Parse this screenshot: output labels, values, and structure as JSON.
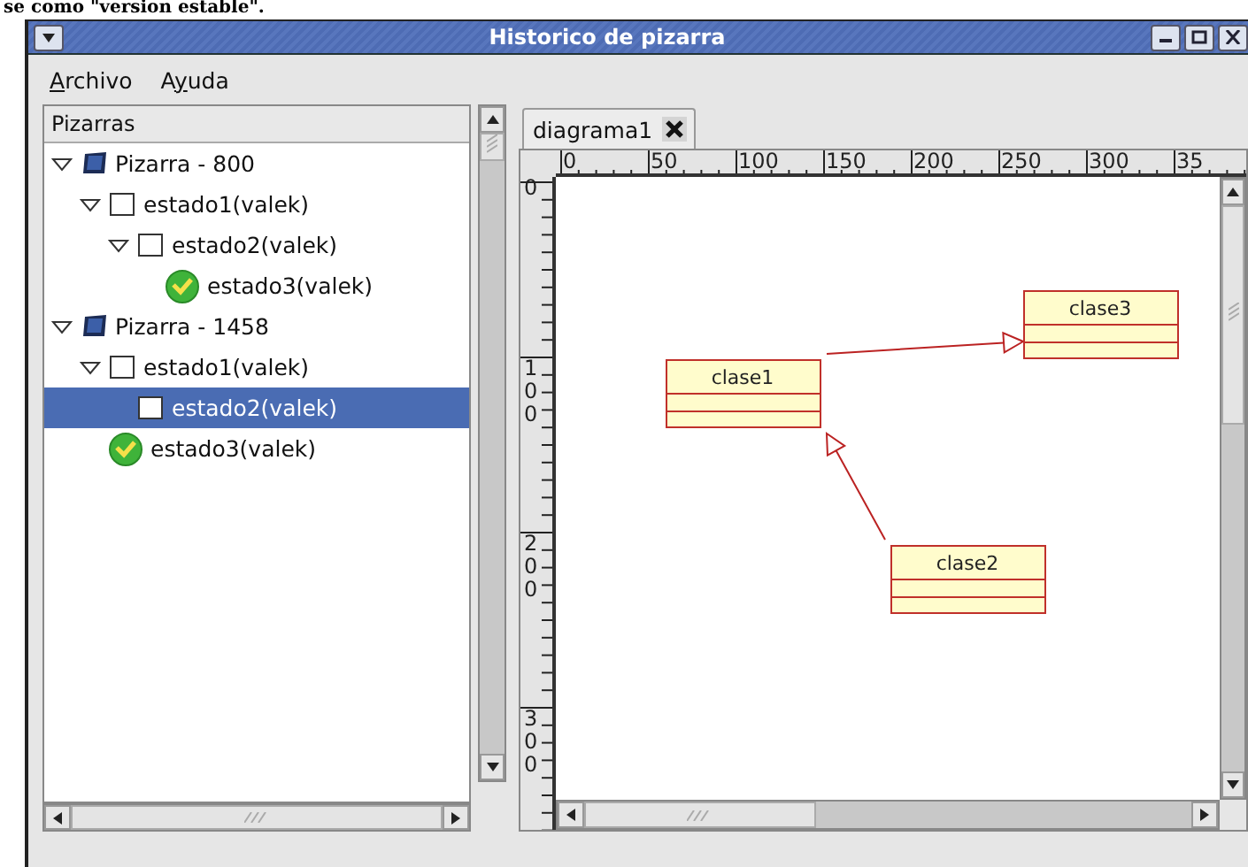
{
  "caption": "se como \"version estable\".",
  "window": {
    "title": "Historico de pizarra"
  },
  "menu": [
    {
      "label": "Archivo"
    },
    {
      "label": "Ayuda"
    }
  ],
  "tree": {
    "header": "Pizarras",
    "items": [
      {
        "label": "Pizarra - 800",
        "kind": "board",
        "expanded": true,
        "selected": false,
        "children": [
          {
            "label": "estado1(valek)",
            "kind": "state",
            "expanded": true,
            "selected": false,
            "children": [
              {
                "label": "estado2(valek)",
                "kind": "state",
                "expanded": true,
                "selected": false,
                "children": [
                  {
                    "label": "estado3(valek)",
                    "kind": "approved",
                    "selected": false
                  }
                ]
              }
            ]
          }
        ]
      },
      {
        "label": "Pizarra - 1458",
        "kind": "board",
        "expanded": true,
        "selected": false,
        "children": [
          {
            "label": "estado1(valek)",
            "kind": "state",
            "expanded": true,
            "selected": false,
            "children": [
              {
                "label": "estado2(valek)",
                "kind": "state",
                "selected": true
              }
            ]
          },
          {
            "label": "estado3(valek)",
            "kind": "approved",
            "selected": false
          }
        ]
      }
    ]
  },
  "tabs": [
    {
      "label": "diagrama1",
      "selected": true
    }
  ],
  "rulers": {
    "horizontal": [
      "0",
      "50",
      "100",
      "150",
      "200",
      "250",
      "300",
      "35"
    ],
    "vertical": [
      "0",
      "100",
      "200",
      "300"
    ]
  },
  "diagram": {
    "classes": [
      {
        "name": "clase1"
      },
      {
        "name": "clase3"
      },
      {
        "name": "clase2"
      }
    ],
    "relations": [
      {
        "kind": "generalization"
      },
      {
        "kind": "generalization"
      }
    ]
  }
}
